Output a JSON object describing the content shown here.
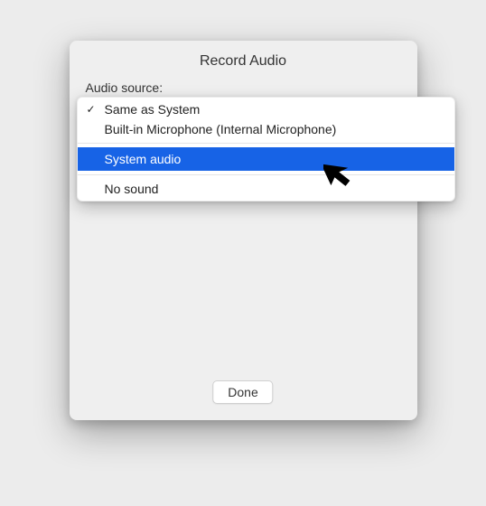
{
  "dialog": {
    "title": "Record Audio",
    "source_label": "Audio source:",
    "done_label": "Done"
  },
  "options": {
    "same_as_system": "Same as System",
    "built_in_mic": "Built-in Microphone (Internal Microphone)",
    "system_audio": "System audio",
    "no_sound": "No sound"
  }
}
